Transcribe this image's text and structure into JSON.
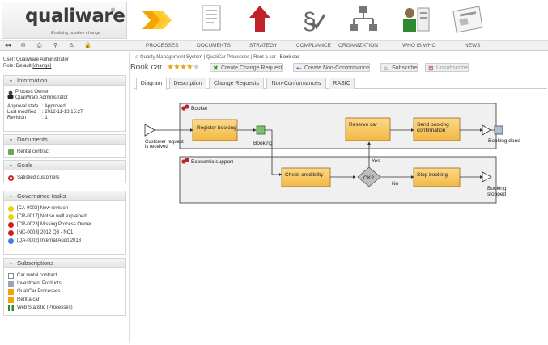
{
  "brand": {
    "name": "qualiware",
    "registered": "®",
    "tagline": "Enabling positive change"
  },
  "nav": {
    "links": [
      "PROCESSES",
      "DOCUMENTS",
      "STRATEGY",
      "COMPLIANCE",
      "ORGANIZATION",
      "WHO IS WHO",
      "NEWS"
    ],
    "toolbar_icons": [
      "back-forward-icon",
      "mail-icon",
      "print-icon",
      "search-icon",
      "user-icon",
      "lock-icon"
    ]
  },
  "user": {
    "line1": "User: QualiWare Administrator",
    "role_prefix": "Role: Default",
    "change": "[change]"
  },
  "panels": {
    "information": {
      "title": "Information",
      "owner_label": "Process Owner:",
      "owner_name": "QualiWare Administrator",
      "approval_label": "Approval state",
      "approval_value": ": Approved",
      "modified_label": "Last modified",
      "modified_value": ": 2012-11-13 15:27",
      "revision_label": "Revision",
      "revision_value": ": 1"
    },
    "documents": {
      "title": "Documents",
      "items": [
        "Rental contract"
      ]
    },
    "goals": {
      "title": "Goals",
      "items": [
        "Satisfied customers"
      ]
    },
    "governance": {
      "title": "Governance tasks",
      "items": [
        {
          "label": "[CA-0002] New revision",
          "color": "#f0d000"
        },
        {
          "label": "[CR-0017] Not so well explained",
          "color": "#f0d000"
        },
        {
          "label": "[CR-0023] Missing Process Owner",
          "color": "#d81b1b"
        },
        {
          "label": "[NC-0003] 2012 Q3 - NC1",
          "color": "#d81b1b"
        },
        {
          "label": "[QA-0002] Internal Audit 2013",
          "color": "#3f7fd6"
        }
      ]
    },
    "subscriptions": {
      "title": "Subscriptions",
      "items": [
        "Car rental contract",
        "Investment Products",
        "QualiCar Processes",
        "Rent a car",
        "Web Statistic (Processes)"
      ]
    }
  },
  "main": {
    "breadcrumb": [
      "Quality Management System",
      "QualiCar Processes",
      "Rent a car",
      "Book car"
    ],
    "title": "Book car",
    "stars_filled": 4,
    "stars_total": 5,
    "buttons": {
      "change_request": "Create Change Request",
      "non_conformance": "Create Non-Conformance",
      "subscribe": "Subscribe",
      "unsubscribe": "Unsubscribe"
    },
    "tabs": [
      "Diagram",
      "Description",
      "Change Requests",
      "Non-Conformances",
      "RASIC"
    ]
  },
  "diagram": {
    "lane_booker": "Booker",
    "lane_economic": "Economic support",
    "start_event": "Customer request is received",
    "register": "Register booking",
    "booking_doc": "Booking",
    "reserve": "Reserve car",
    "send_confirm": "Send booking confirmation",
    "booking_done": "Booking done",
    "check_credibility": "Check credibility",
    "gateway": "OK?",
    "yes": "Yes",
    "no": "No",
    "stop_booking": "Stop booking",
    "booking_stopped": "Booking stopped"
  },
  "colors": {
    "task_fill": "#f6c25a",
    "task_stroke": "#9c6a12",
    "lane_fill": "#f0f0f0"
  }
}
